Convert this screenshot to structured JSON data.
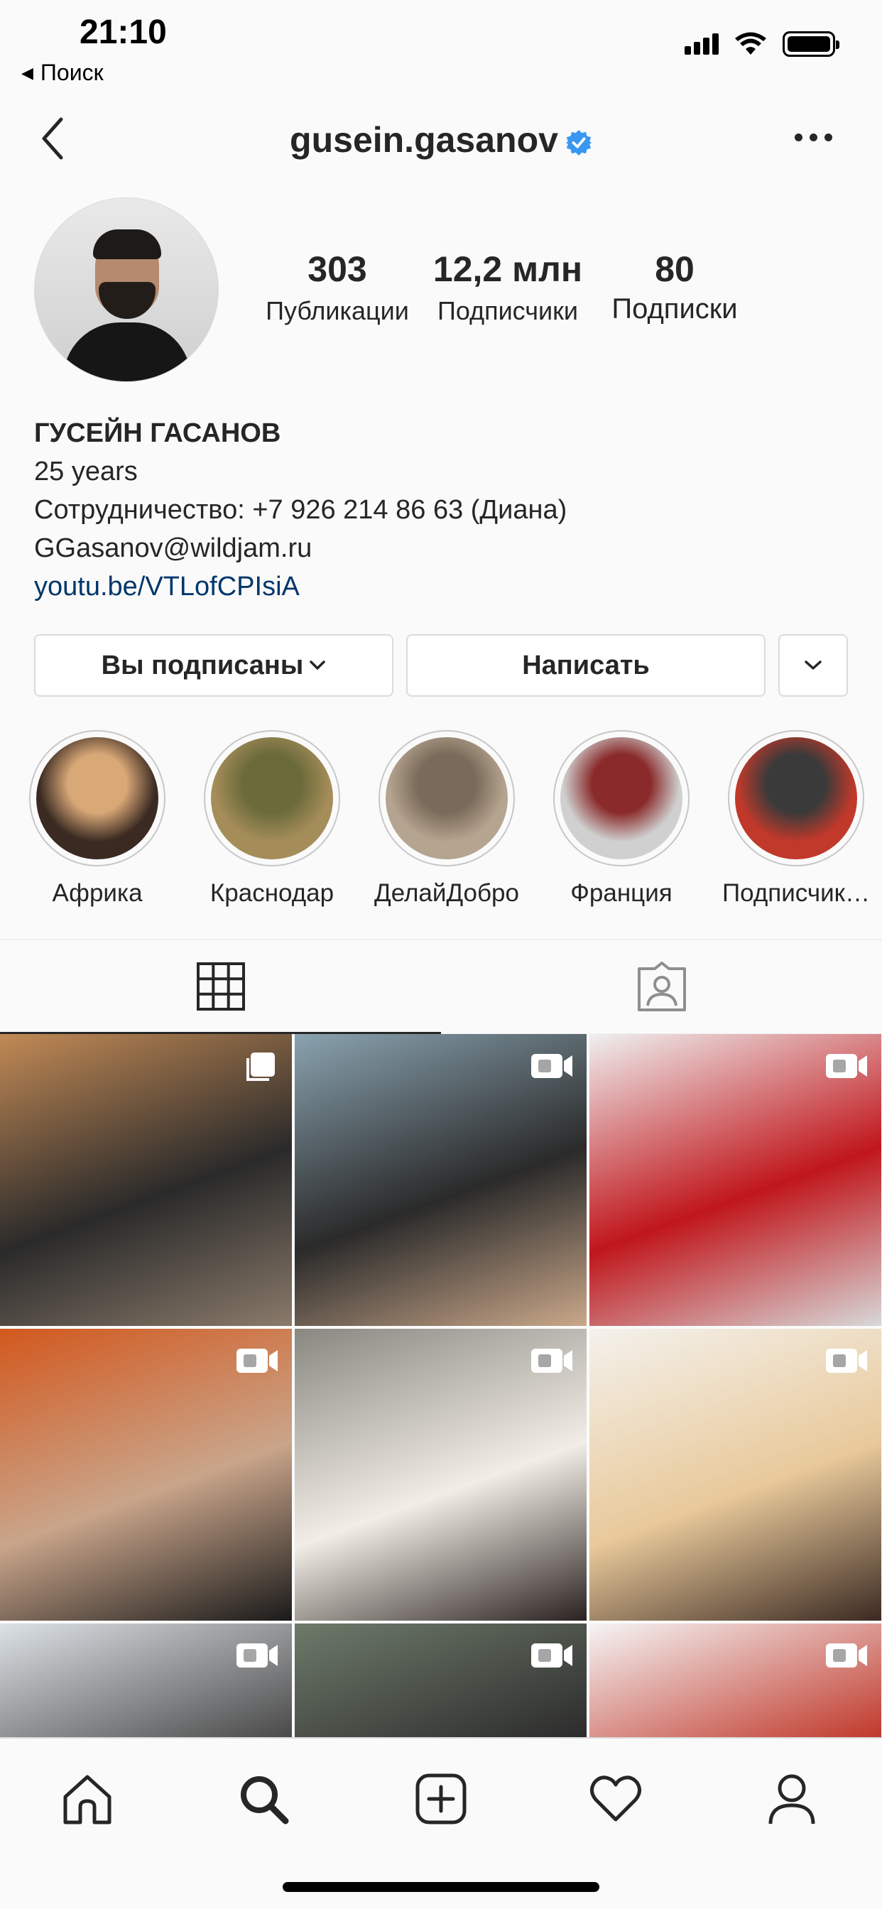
{
  "status_bar": {
    "time": "21:10",
    "back_app_label": "Поиск"
  },
  "nav": {
    "username": "gusein.gasanov",
    "verified": true
  },
  "profile": {
    "stats": {
      "posts": {
        "value": "303",
        "label": "Публикации"
      },
      "followers": {
        "value": "12,2 млн",
        "label": "Подписчики"
      },
      "following": {
        "value": "80",
        "label": "Подписки"
      }
    },
    "bio": {
      "name": "ГУСЕЙН ГАСАНОВ",
      "line1": "25 years",
      "line2": "Сотрудничество: +7 926 214 86 63 (Диана)",
      "line3": "GGasanov@wildjam.ru",
      "link": "youtu.be/VTLofCPIsiA"
    }
  },
  "actions": {
    "following_label": "Вы подписаны",
    "message_label": "Написать"
  },
  "highlights": [
    {
      "label": "Африка",
      "colors": [
        "#d9a877",
        "#3a2a22"
      ]
    },
    {
      "label": "Краснодар",
      "colors": [
        "#6b6a3a",
        "#a58d5a"
      ]
    },
    {
      "label": "ДелайДобро",
      "colors": [
        "#7a6a5a",
        "#b5a48f"
      ]
    },
    {
      "label": "Франция",
      "colors": [
        "#8a2a2a",
        "#d0d0d0"
      ]
    },
    {
      "label": "Подписчик…",
      "colors": [
        "#3a3a3a",
        "#c0392b"
      ]
    }
  ],
  "tabs": {
    "grid_icon": "grid-icon",
    "tagged_icon": "tagged-person-icon"
  },
  "posts": [
    {
      "type": "multi",
      "colors": [
        "#c28a55",
        "#2a2a2a",
        "#8a7a6a"
      ]
    },
    {
      "type": "video",
      "colors": [
        "#8aa3b0",
        "#2a2a2a",
        "#caa88a"
      ]
    },
    {
      "type": "video",
      "colors": [
        "#f0f0f0",
        "#c0161b",
        "#d8d8d8"
      ]
    },
    {
      "type": "video",
      "colors": [
        "#d2581e",
        "#c9a58a",
        "#1a1a1a"
      ]
    },
    {
      "type": "video",
      "colors": [
        "#888880",
        "#f2ede6",
        "#2a2220"
      ]
    },
    {
      "type": "video",
      "colors": [
        "#f4f1ec",
        "#e8c99a",
        "#3b2a22"
      ]
    },
    {
      "type": "video",
      "colors": [
        "#dde2e6",
        "#4a4a4a",
        "#b8b8b8"
      ]
    },
    {
      "type": "video",
      "colors": [
        "#6e7a6a",
        "#2c2c2c",
        "#b03a2a"
      ]
    },
    {
      "type": "video",
      "colors": [
        "#f5f5f5",
        "#c0392b",
        "#8a7060"
      ]
    }
  ],
  "tabbar": [
    "home-icon",
    "search-icon",
    "new-post-icon",
    "activity-heart-icon",
    "profile-icon"
  ]
}
